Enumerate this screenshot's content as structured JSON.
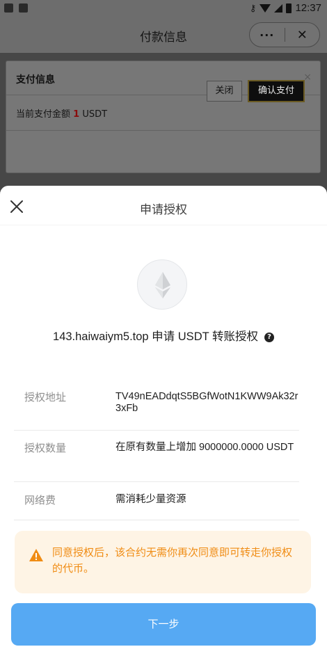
{
  "status_bar": {
    "time": "12:37",
    "left_icons": [
      "cat-app-icon",
      "notification-a-icon"
    ],
    "right_icons": [
      "key-icon",
      "wifi-icon",
      "signal-icon",
      "battery-icon"
    ]
  },
  "nav": {
    "title": "付款信息",
    "more_label": "···",
    "close_label": "✕"
  },
  "pay_dialog": {
    "title": "支付信息",
    "close_label": "×",
    "amount_prefix": "当前支付金额 ",
    "amount_value": "1",
    "amount_suffix": " USDT",
    "close_button": "关闭",
    "confirm_button": "确认支付"
  },
  "sheet": {
    "title": "申请授权",
    "auth_text": "143.haiwaiym5.top 申请 USDT 转账授权",
    "help_label": "?",
    "token_icon": "ethereum-icon",
    "details": [
      {
        "label": "授权地址",
        "value": "TV49nEADdqtS5BGfWotN1KWW9Ak32r3xFb"
      },
      {
        "label": "授权数量",
        "value": "在原有数量上增加 9000000.0000 USDT"
      },
      {
        "label": "网络费",
        "value": "需消耗少量资源"
      }
    ],
    "warning_text": "同意授权后，该合约无需你再次同意即可转走你授权的代币。",
    "next_button": "下一步"
  },
  "colors": {
    "accent_blue": "#56a9f3",
    "warning_orange": "#f08c14",
    "warning_bg": "#fef4e5",
    "amount_red": "#8a0c0c"
  }
}
